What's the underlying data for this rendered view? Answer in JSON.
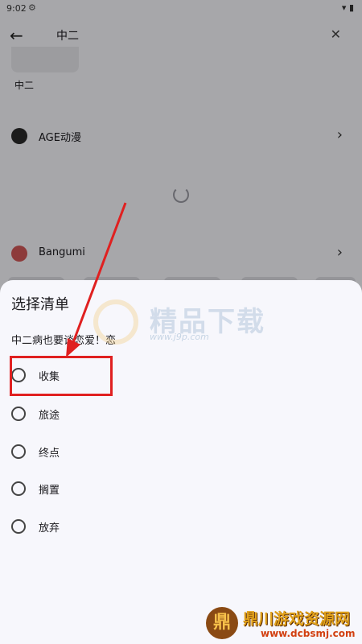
{
  "status": {
    "time": "9:02",
    "gear_icon": "gear-icon",
    "right_icons": "▾ ▮"
  },
  "appbar": {
    "back_icon": "arrow-left-icon",
    "query": "中二",
    "clear_icon": "close-icon"
  },
  "results": {
    "first_title": "中二",
    "sources": [
      {
        "name": "AGE动漫",
        "icon": "age-logo-icon"
      },
      {
        "name": "Bangumi",
        "icon": "bangumi-logo-icon"
      }
    ]
  },
  "sheet": {
    "title": "选择清单",
    "subtitle": "中二病也要谈恋爱！恋",
    "options": [
      "收集",
      "旅途",
      "终点",
      "搁置",
      "放弃"
    ]
  },
  "watermark": {
    "text": "精品下载",
    "url": "www.j9p.com"
  },
  "brand": {
    "emblem": "鼎",
    "name": "鼎川游戏资源网",
    "url": "www.dcbsmj.com"
  },
  "colors": {
    "highlight": "#e02020",
    "sheet_bg": "#f7f7fc"
  }
}
